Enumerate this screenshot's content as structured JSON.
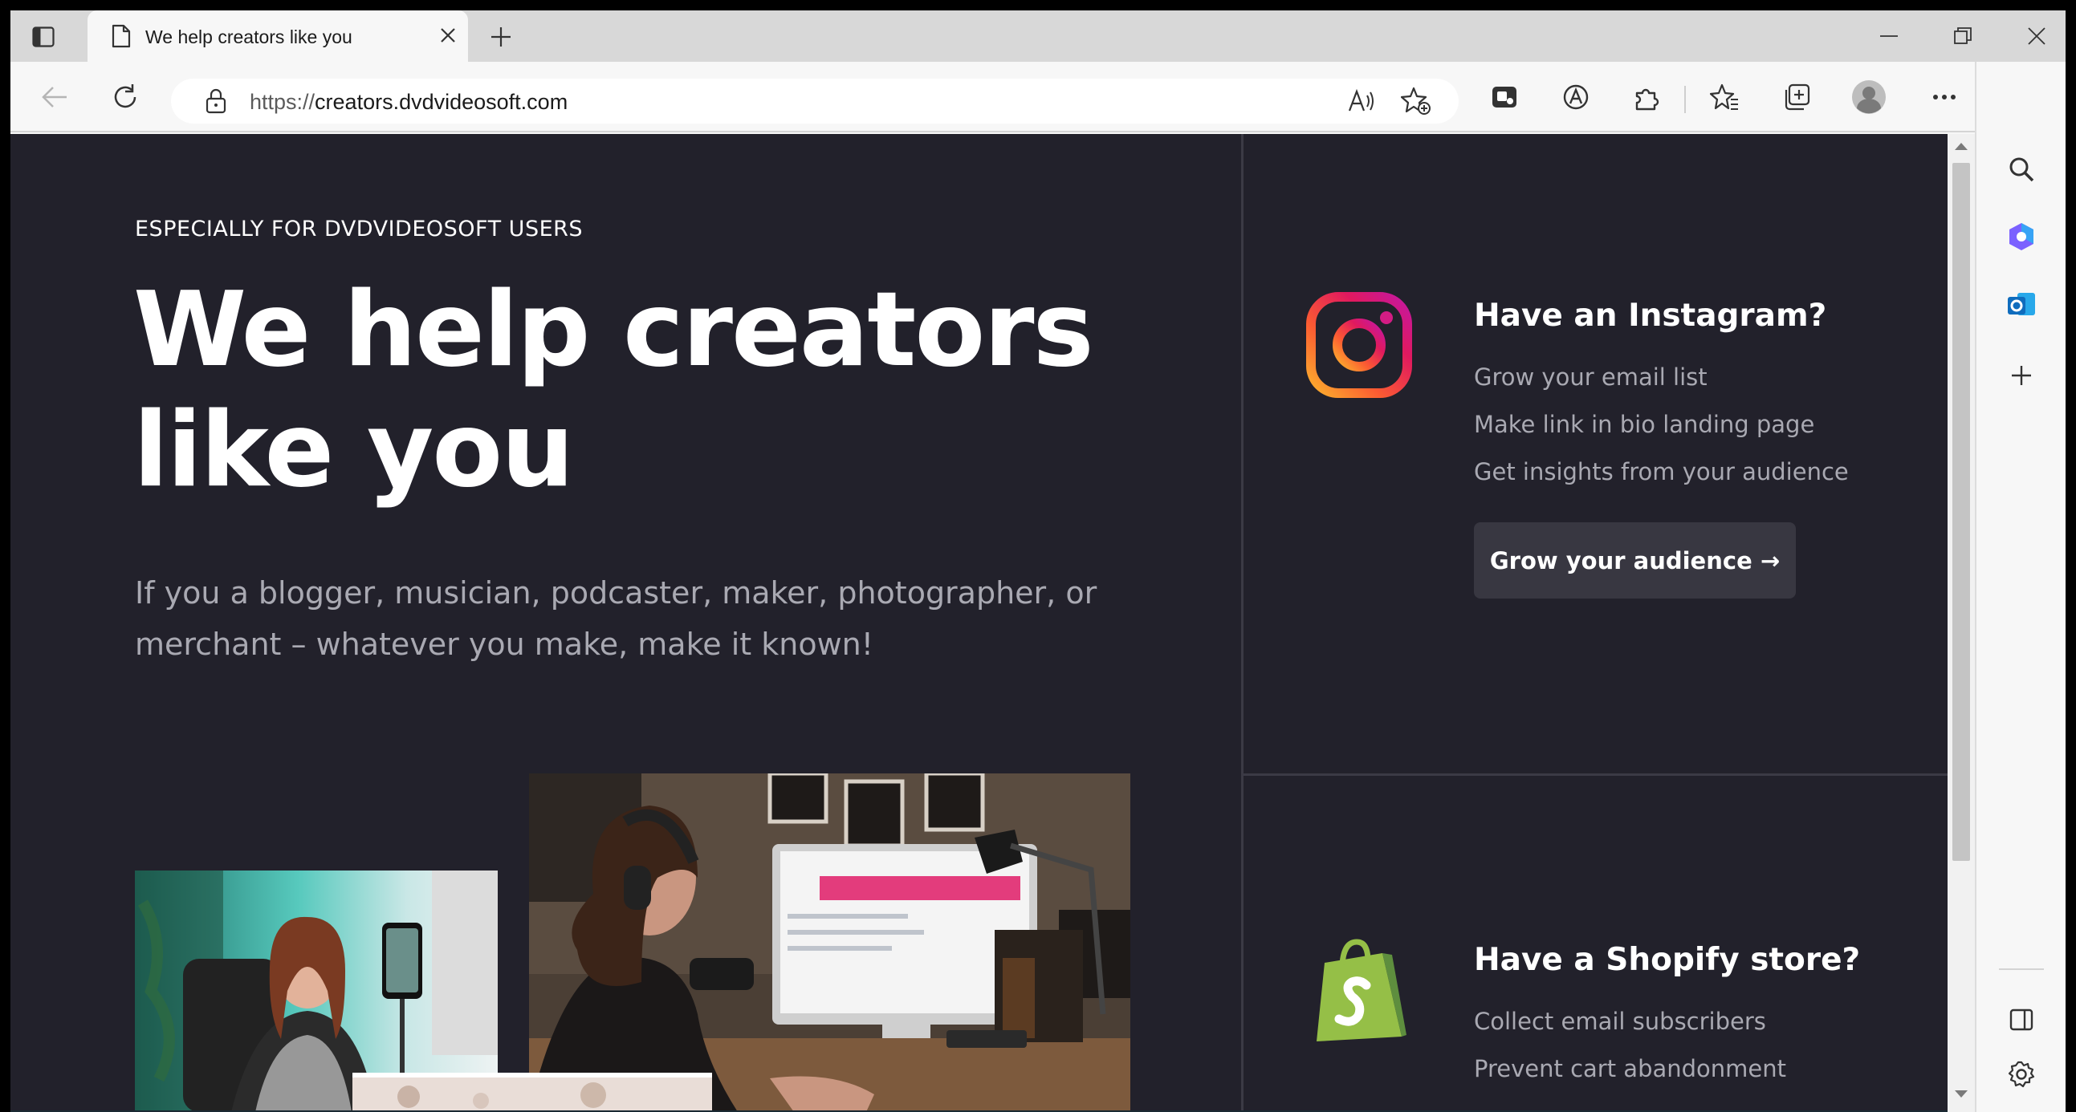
{
  "browser": {
    "tab_title": "We help creators like you",
    "url_protocol": "https://",
    "url_host": "creators.dvdvideosoft.com"
  },
  "page": {
    "eyebrow": "ESPECIALLY FOR DVDVIDEOSOFT USERS",
    "hero_line1": "We help creators",
    "hero_line2": "like you",
    "lede": "If you a blogger, musician, podcaster, maker, photographer, or merchant – whatever you make, make it known!",
    "instagram": {
      "title": "Have an Instagram?",
      "items": [
        "Grow your email list",
        "Make link in bio landing page",
        "Get insights from your audience"
      ],
      "button": "Grow your audience →"
    },
    "shopify": {
      "title": "Have a Shopify store?",
      "items": [
        "Collect email subscribers",
        "Prevent cart abandonment"
      ]
    }
  },
  "colors": {
    "page_bg": "#22212b",
    "shopify_green": "#95bf47",
    "edge_blue": "#0f6cbd"
  },
  "icons": {
    "instagram": "instagram-logo-icon",
    "shopify": "shopify-bag-icon"
  }
}
